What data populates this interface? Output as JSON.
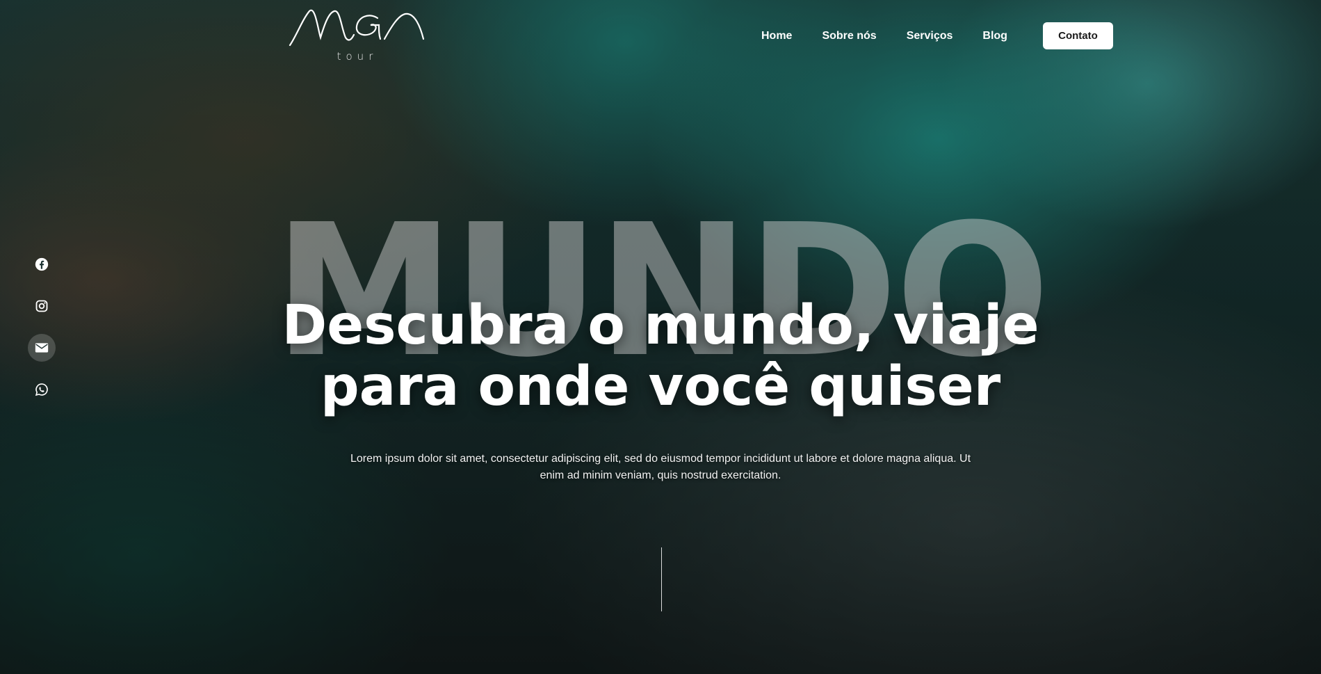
{
  "brand": {
    "logo_script": "MGA",
    "logo_sub": "tour"
  },
  "nav": {
    "items": [
      {
        "label": "Home"
      },
      {
        "label": "Sobre nós"
      },
      {
        "label": "Serviços"
      },
      {
        "label": "Blog"
      }
    ],
    "cta": "Contato"
  },
  "social": [
    {
      "icon": "facebook-icon"
    },
    {
      "icon": "instagram-icon"
    },
    {
      "icon": "email-icon"
    },
    {
      "icon": "whatsapp-icon"
    }
  ],
  "hero": {
    "background_word": "MUNDO",
    "headline_line1": "Descubra o mundo, viaje",
    "headline_line2": "para onde você quiser",
    "description": "Lorem ipsum dolor sit amet, consectetur adipiscing elit, sed do eiusmod tempor incididunt ut labore et dolore magna aliqua. Ut enim ad minim veniam, quis nostrud exercitation."
  },
  "colors": {
    "cta_bg": "#ffffff",
    "text": "#ffffff"
  }
}
